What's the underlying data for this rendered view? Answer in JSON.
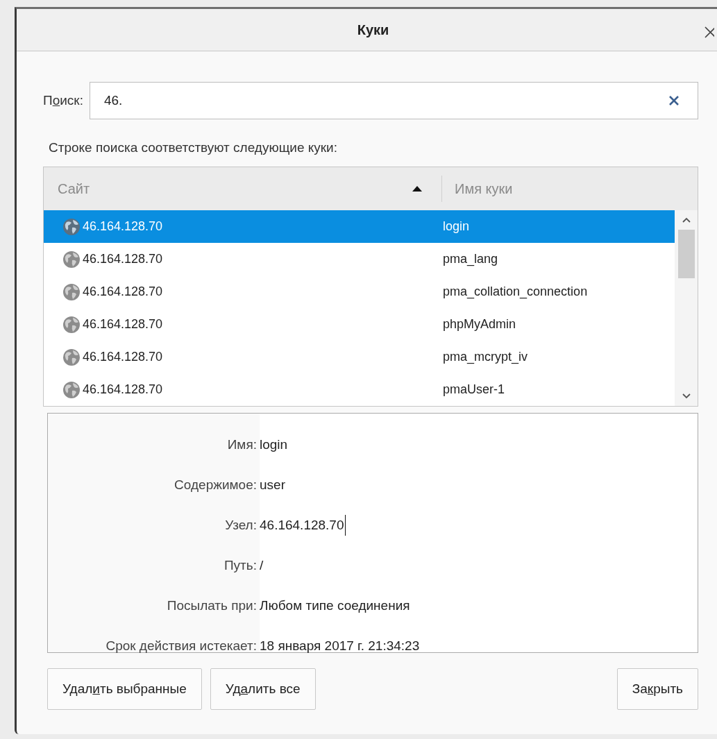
{
  "window": {
    "title": "Куки"
  },
  "search": {
    "label": {
      "before": "П",
      "key": "о",
      "after": "иск:"
    },
    "value": "46."
  },
  "matches_label": "Строке поиска соответствуют следующие куки:",
  "table": {
    "columns": [
      {
        "label": "Сайт",
        "sorted": true
      },
      {
        "label": "Имя куки",
        "sorted": false
      }
    ],
    "rows": [
      {
        "site": "46.164.128.70",
        "name": "login",
        "selected": true
      },
      {
        "site": "46.164.128.70",
        "name": "pma_lang",
        "selected": false
      },
      {
        "site": "46.164.128.70",
        "name": "pma_collation_connection",
        "selected": false
      },
      {
        "site": "46.164.128.70",
        "name": "phpMyAdmin",
        "selected": false
      },
      {
        "site": "46.164.128.70",
        "name": "pma_mcrypt_iv",
        "selected": false
      },
      {
        "site": "46.164.128.70",
        "name": "pmaUser-1",
        "selected": false
      }
    ]
  },
  "details": [
    {
      "label": "Имя:",
      "value": "login",
      "focused": false
    },
    {
      "label": "Содержимое:",
      "value": "user",
      "focused": false
    },
    {
      "label": "Узел:",
      "value": "46.164.128.70",
      "focused": true
    },
    {
      "label": "Путь:",
      "value": "/",
      "focused": false
    },
    {
      "label": "Посылать при:",
      "value": "Любом типе соединения",
      "focused": false
    },
    {
      "label": "Срок действия истекает:",
      "value": "18 января 2017 г. 21:34:23",
      "focused": false
    }
  ],
  "buttons": [
    {
      "label": {
        "before": "Удал",
        "key": "и",
        "after": "ть выбранные"
      },
      "kind": "action"
    },
    {
      "label": {
        "before": "Уд",
        "key": "а",
        "after": "лить все"
      },
      "kind": "action"
    },
    {
      "label": {
        "before": "За",
        "key": "к",
        "after": "рыть"
      },
      "kind": "close"
    }
  ]
}
